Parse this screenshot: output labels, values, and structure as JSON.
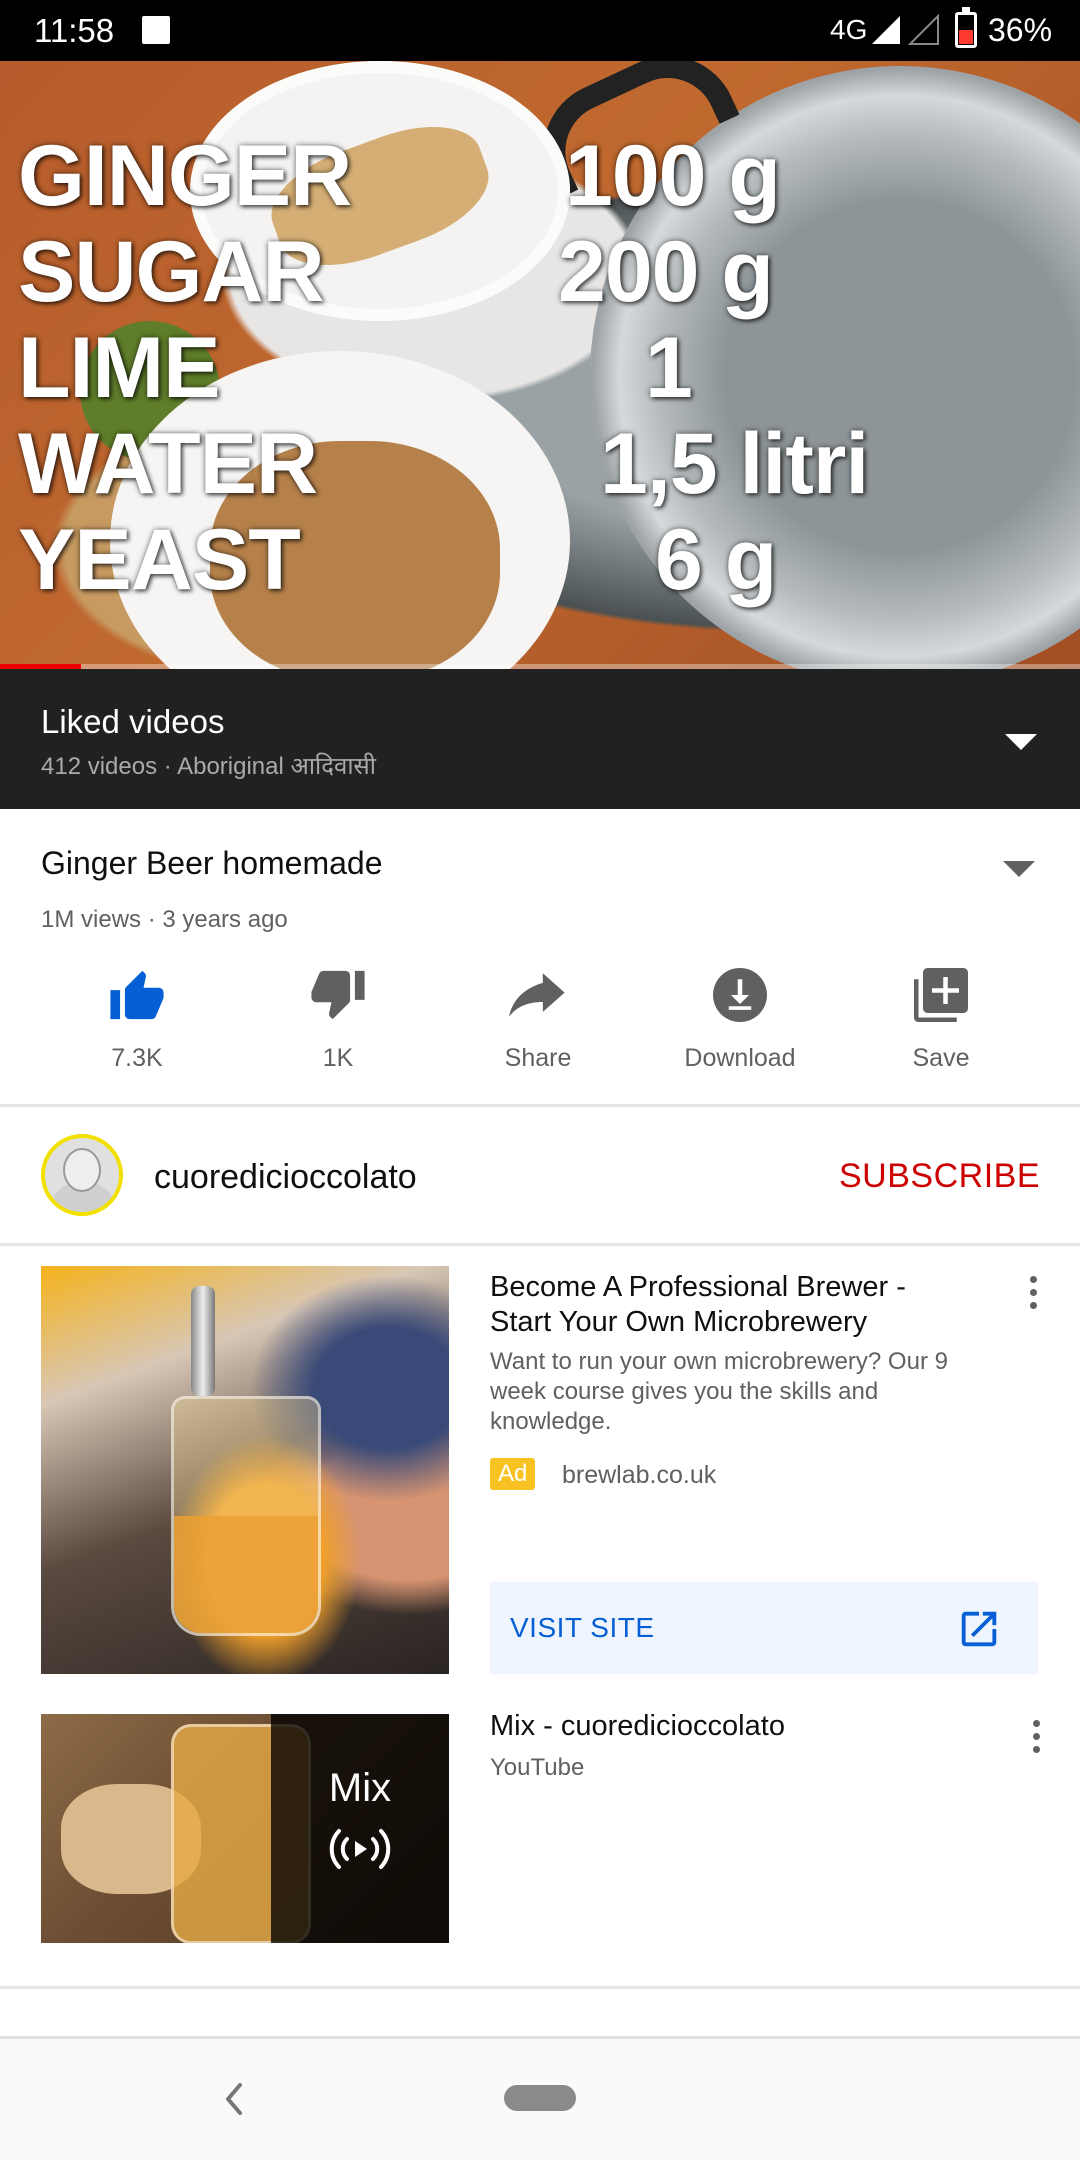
{
  "status_bar": {
    "time": "11:58",
    "network": "4G",
    "battery": "36%",
    "battery_level": 0.36
  },
  "video": {
    "overlay_rows": [
      {
        "ingredient": "GINGER",
        "amount": "100 g"
      },
      {
        "ingredient": "SUGAR",
        "amount": "200 g"
      },
      {
        "ingredient": "LIME",
        "amount": "1"
      },
      {
        "ingredient": "WATER",
        "amount": "1,5 litri"
      },
      {
        "ingredient": "YEAST",
        "amount": "6 g"
      }
    ],
    "progress_fraction": 0.075,
    "progress_color": "#ee0000"
  },
  "playlist": {
    "title": "Liked videos",
    "subtitle": "412 videos · Aboriginal आदिवासी"
  },
  "video_info": {
    "title": "Ginger Beer homemade",
    "meta": "1M views · 3 years ago"
  },
  "actions": [
    {
      "icon": "thumbs-up-icon",
      "label": "7.3K",
      "active": true
    },
    {
      "icon": "thumbs-down-icon",
      "label": "1K"
    },
    {
      "icon": "share-icon",
      "label": "Share"
    },
    {
      "icon": "download-icon",
      "label": "Download"
    },
    {
      "icon": "save-to-playlist-icon",
      "label": "Save"
    }
  ],
  "channel": {
    "name": "cuoredicioccolato",
    "subscribe_label": "SUBSCRIBE"
  },
  "ad": {
    "title": "Become A Professional Brewer - Start Your Own Microbrewery",
    "description": "Want to run your own microbrewery? Our 9 week course gives you the skills and knowledge.",
    "badge": "Ad",
    "domain": "brewlab.co.uk",
    "cta_label": "VISIT SITE"
  },
  "mix": {
    "overlay_label": "Mix",
    "title": "Mix - cuoredicioccolato",
    "subtitle": "YouTube"
  },
  "colors": {
    "accent_blue": "#065fd4",
    "subscribe_red": "#cc0000",
    "like_active": "#065fd4",
    "ad_badge": "#f9c223"
  }
}
